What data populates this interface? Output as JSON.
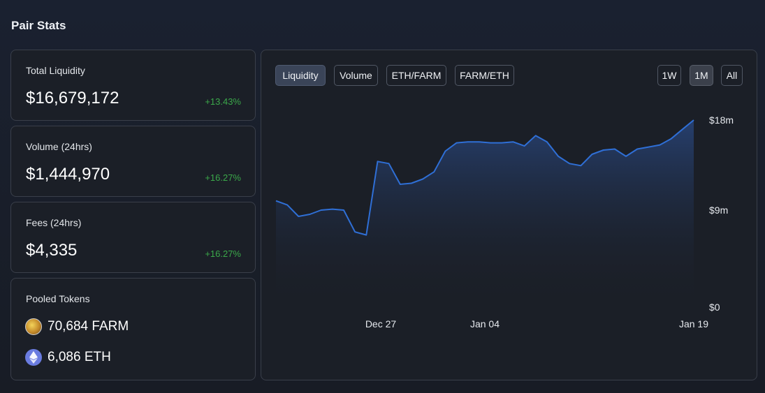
{
  "page": {
    "title": "Pair Stats"
  },
  "stats": [
    {
      "label": "Total Liquidity",
      "value": "$16,679,172",
      "change": "+13.43%"
    },
    {
      "label": "Volume (24hrs)",
      "value": "$1,444,970",
      "change": "+16.27%"
    },
    {
      "label": "Fees (24hrs)",
      "value": "$4,335",
      "change": "+16.27%"
    }
  ],
  "pooled": {
    "label": "Pooled Tokens",
    "tokens": [
      {
        "amount": "70,684 FARM",
        "icon": "farm-token-icon"
      },
      {
        "amount": "6,086 ETH",
        "icon": "eth-token-icon"
      }
    ]
  },
  "chart_tabs": [
    {
      "label": "Liquidity",
      "active": true
    },
    {
      "label": "Volume",
      "active": false
    },
    {
      "label": "ETH/FARM",
      "active": false
    },
    {
      "label": "FARM/ETH",
      "active": false
    }
  ],
  "range_tabs": [
    {
      "label": "1W",
      "active": false
    },
    {
      "label": "1M",
      "active": true
    },
    {
      "label": "All",
      "active": false
    }
  ],
  "chart_data": {
    "type": "area",
    "title": "",
    "xlabel": "",
    "ylabel": "",
    "y_ticks": [
      "$18m",
      "$9m",
      "$0"
    ],
    "ylim": [
      0,
      18
    ],
    "x_ticks": [
      "Dec 27",
      "Jan 04",
      "Jan 19"
    ],
    "color": "#2f6fd6",
    "series": [
      {
        "values": [
          10.2,
          9.8,
          8.7,
          8.9,
          9.3,
          9.4,
          9.3,
          7.2,
          6.9,
          14.0,
          13.8,
          11.8,
          11.9,
          12.3,
          13.0,
          15.0,
          15.8,
          15.9,
          15.9,
          15.8,
          15.8,
          15.9,
          15.5,
          16.5,
          15.9,
          14.5,
          13.8,
          13.6,
          14.7,
          15.1,
          15.2,
          14.5,
          15.2,
          15.4,
          15.6,
          16.2,
          17.1,
          18.0
        ]
      }
    ]
  }
}
